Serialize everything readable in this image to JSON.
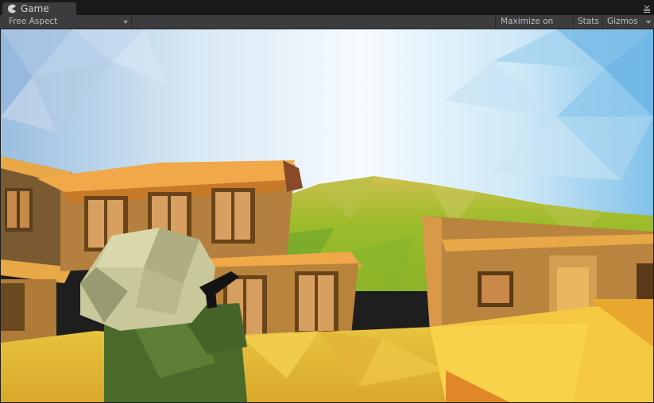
{
  "window": {
    "tab_label": "Game",
    "tab_icon": "pacman-game-icon",
    "tab_menu_icon": "window-menu-icon"
  },
  "toolbar": {
    "aspect_label": "Free Aspect",
    "maximize_label": "Maximize on Play",
    "stats_label": "Stats",
    "gizmos_label": "Gizmos"
  },
  "colors": {
    "panel_bg": "#3c3c3c",
    "tabstrip_bg": "#191919",
    "text": "#bdbdbd",
    "sky_blue": "#8fc0e8",
    "terrain_yellow": "#e8c83a",
    "building_tan": "#c89a5a",
    "roof_orange": "#e89a3a",
    "soldier_green": "#5a7a3a"
  }
}
